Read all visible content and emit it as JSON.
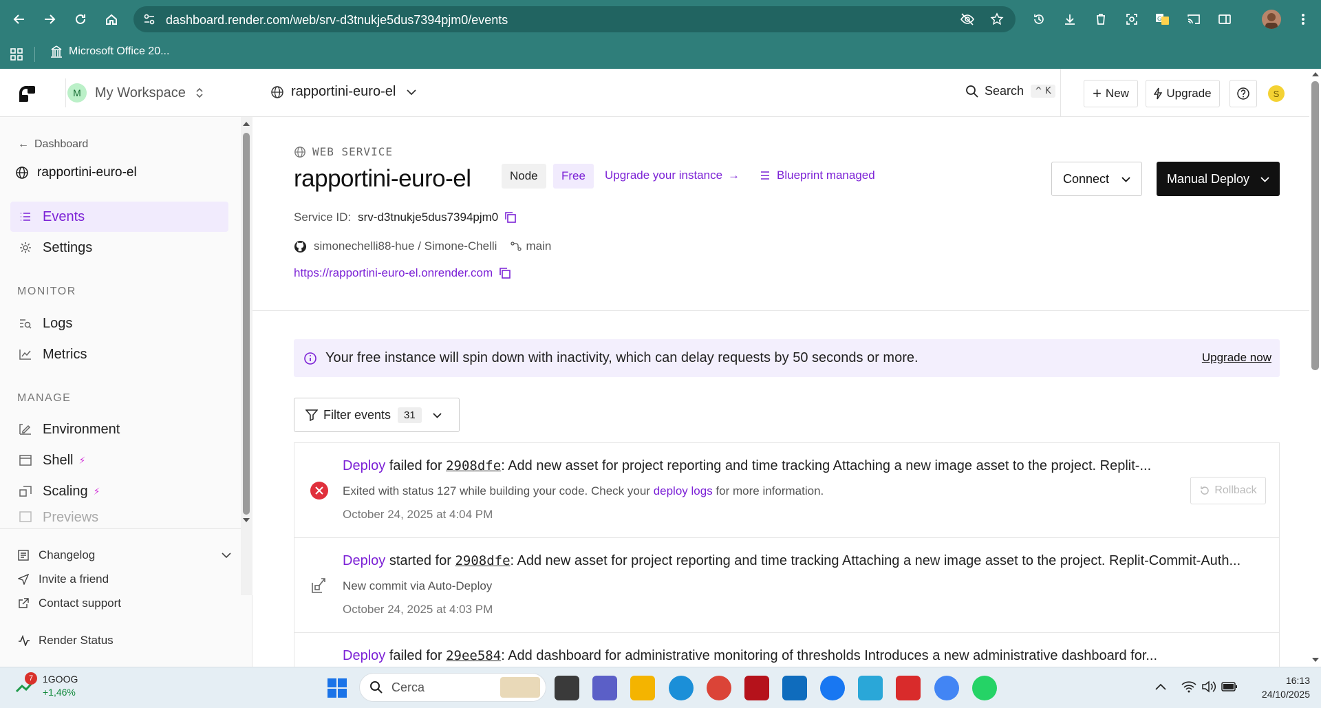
{
  "browser": {
    "url": "dashboard.render.com/web/srv-d3tnukje5dus7394pjm0/events",
    "bookmark": "Microsoft Office 20..."
  },
  "sidebar": {
    "workspace_initial": "M",
    "workspace_name": "My Workspace",
    "back_label": "Dashboard",
    "service_name": "rapportini-euro-el",
    "items": [
      {
        "label": "Events",
        "icon": "list-icon",
        "active": true
      },
      {
        "label": "Settings",
        "icon": "gear-icon"
      }
    ],
    "monitor_title": "MONITOR",
    "monitor_items": [
      {
        "label": "Logs",
        "icon": "logs-icon"
      },
      {
        "label": "Metrics",
        "icon": "chart-icon"
      }
    ],
    "manage_title": "MANAGE",
    "manage_items": [
      {
        "label": "Environment",
        "icon": "env-icon"
      },
      {
        "label": "Shell",
        "icon": "terminal-icon",
        "bolt": true
      },
      {
        "label": "Scaling",
        "icon": "scaling-icon",
        "bolt": true
      },
      {
        "label": "Previews",
        "icon": "previews-icon"
      }
    ],
    "bottom": {
      "changelog": "Changelog",
      "invite": "Invite a friend",
      "support": "Contact support",
      "status": "Render Status"
    }
  },
  "topbar": {
    "service": "rapportini-euro-el",
    "search": "Search",
    "shortcut": "^ K",
    "new": "New",
    "upgrade": "Upgrade",
    "avatar": "S"
  },
  "service": {
    "type": "WEB SERVICE",
    "name": "rapportini-euro-el",
    "runtime": "Node",
    "plan": "Free",
    "upgrade_link": "Upgrade your instance",
    "blueprint": "Blueprint managed",
    "id_label": "Service ID:",
    "id": "srv-d3tnukje5dus7394pjm0",
    "repo": "simonechelli88-hue / Simone-Chelli",
    "branch": "main",
    "url": "https://rapportini-euro-el.onrender.com",
    "connect": "Connect",
    "manual_deploy": "Manual Deploy"
  },
  "banner": {
    "text": "Your free instance will spin down with inactivity, which can delay requests by 50 seconds or more.",
    "link": "Upgrade now"
  },
  "filter": {
    "label": "Filter events",
    "count": "31"
  },
  "events": [
    {
      "kind": "Deploy",
      "status": "failed for",
      "sha": "2908dfe",
      "message": ": Add new asset for project reporting and time tracking Attaching a new image asset to the project. Replit-...",
      "sub_pre": "Exited with status 127 while building your code. Check your ",
      "sub_link": "deploy logs",
      "sub_post": " for more information.",
      "date": "October 24, 2025 at 4:04 PM",
      "action": "Rollback"
    },
    {
      "kind": "Deploy",
      "status": "started for",
      "sha": "2908dfe",
      "message": ": Add new asset for project reporting and time tracking Attaching a new image asset to the project. Replit-Commit-Auth...",
      "sub": "New commit via Auto-Deploy",
      "date": "October 24, 2025 at 4:03 PM"
    },
    {
      "kind": "Deploy",
      "status": "failed for",
      "sha": "29ee584",
      "message": ": Add dashboard for administrative monitoring of thresholds Introduces a new administrative dashboard for..."
    }
  ],
  "taskbar": {
    "stock_badge": "7",
    "stock_name": "1GOOG",
    "stock_change": "+1,46%",
    "search": "Cerca",
    "time": "16:13",
    "date": "24/10/2025"
  }
}
